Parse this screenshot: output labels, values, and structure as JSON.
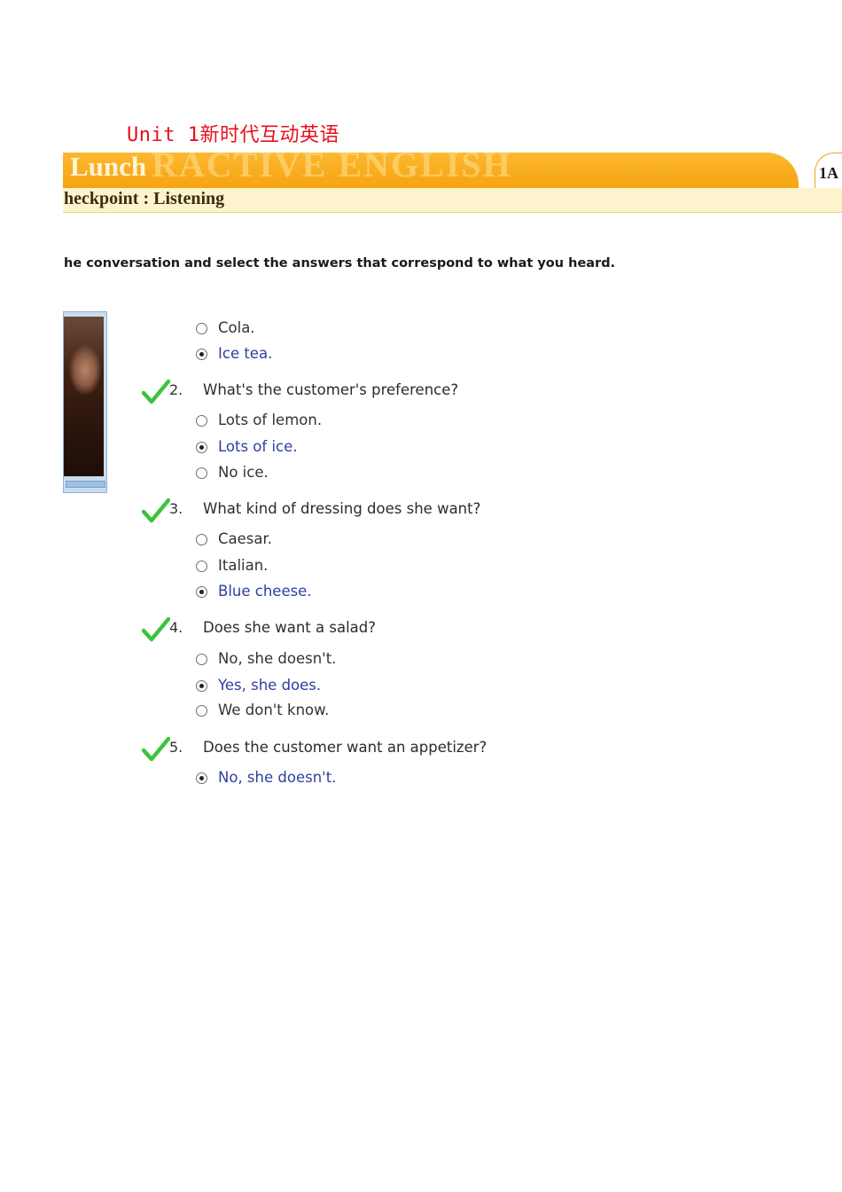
{
  "doc_title": "Unit 1新时代互动英语",
  "banner": {
    "title": "Lunch",
    "watermark": "RACTIVE ENGLISH",
    "tab_label": "1A",
    "color": "#f6a312"
  },
  "subheader": "heckpoint : Listening",
  "instruction": "he conversation and select the answers that correspond to what you heard.",
  "colors": {
    "accent": "#f6a312",
    "check": "#3cc43c",
    "selected_text": "#2e3ea0"
  },
  "questions": [
    {
      "number": "",
      "text": "",
      "correct": false,
      "options": [
        {
          "label": "Cola.",
          "selected": false
        },
        {
          "label": "Ice tea.",
          "selected": true
        }
      ]
    },
    {
      "number": "2.",
      "text": "What's the customer's preference?",
      "correct": true,
      "icon": "check-icon",
      "options": [
        {
          "label": "Lots of lemon.",
          "selected": false
        },
        {
          "label": "Lots of ice.",
          "selected": true
        },
        {
          "label": "No ice.",
          "selected": false
        }
      ]
    },
    {
      "number": "3.",
      "text": "What kind of dressing does she want?",
      "correct": true,
      "icon": "check-icon",
      "options": [
        {
          "label": "Caesar.",
          "selected": false
        },
        {
          "label": "Italian.",
          "selected": false
        },
        {
          "label": "Blue cheese.",
          "selected": true
        }
      ]
    },
    {
      "number": "4.",
      "text": "Does she want a salad?",
      "correct": true,
      "icon": "check-icon",
      "options": [
        {
          "label": "No, she doesn't.",
          "selected": false
        },
        {
          "label": "Yes, she does.",
          "selected": true
        },
        {
          "label": "We don't know.",
          "selected": false
        }
      ]
    },
    {
      "number": "5.",
      "text": "Does the customer want an appetizer?",
      "correct": true,
      "icon": "check-icon",
      "options": [
        {
          "label": "No, she doesn't.",
          "selected": true
        }
      ]
    }
  ]
}
